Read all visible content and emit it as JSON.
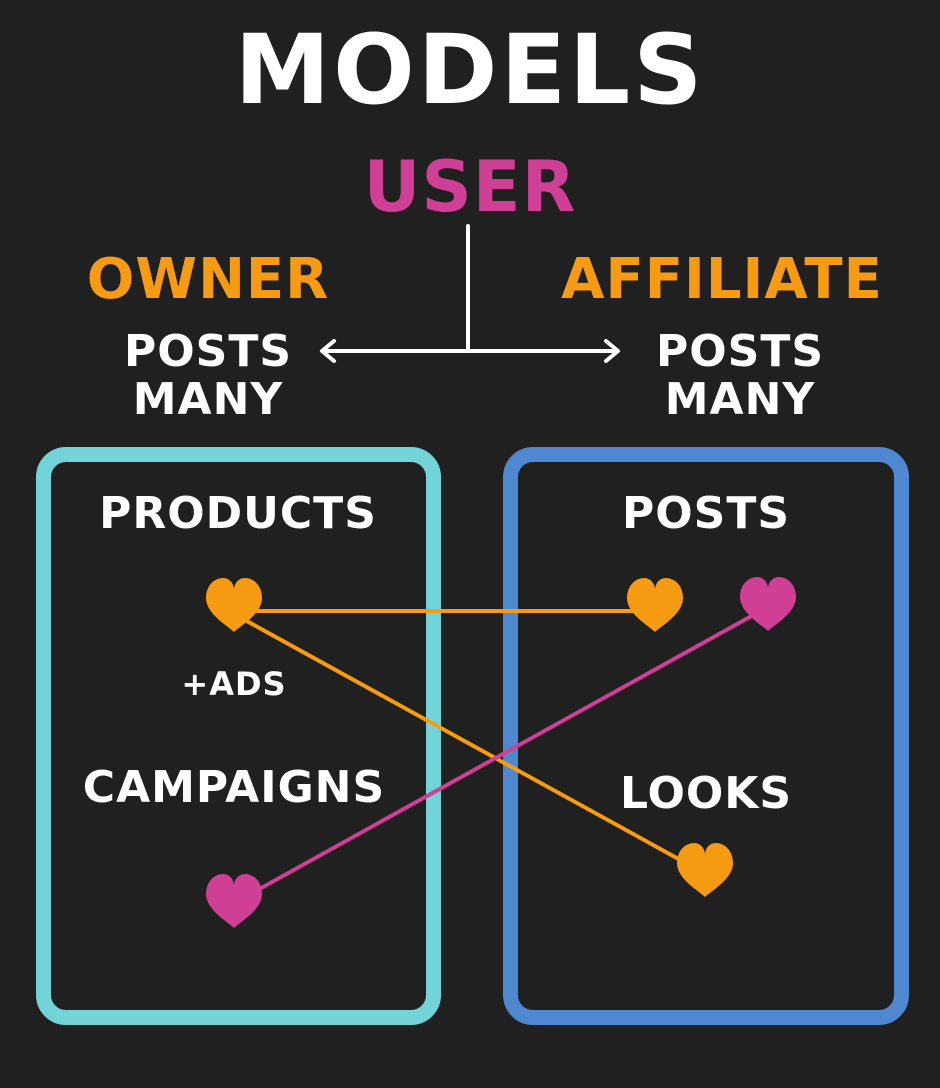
{
  "title": "MODELS",
  "root": {
    "label": "USER"
  },
  "roles": [
    {
      "id": "owner",
      "label": "OWNER",
      "relation_line1": "POSTS",
      "relation_line2": "MANY"
    },
    {
      "id": "affiliate",
      "label": "AFFILIATE",
      "relation_line1": "POSTS",
      "relation_line2": "MANY"
    }
  ],
  "groups": {
    "owner": {
      "products": "PRODUCTS",
      "ads_note": "+ADS",
      "campaigns": "CAMPAIGNS"
    },
    "affiliate": {
      "posts": "POSTS",
      "looks": "LOOKS"
    }
  },
  "colors": {
    "background": "#202020",
    "title": "#ffffff",
    "user": "#cf3f95",
    "role": "#f79c12",
    "owner_box": "#72d3d9",
    "affiliate_box": "#4f87d0",
    "orange_link": "#f79c12",
    "pink_link": "#cf3f95"
  },
  "icons": [
    "heart-icon",
    "arrow-left-icon",
    "arrow-right-icon"
  ],
  "links": [
    {
      "from": "products",
      "to": "posts",
      "color": "orange"
    },
    {
      "from": "products",
      "to": "looks",
      "color": "orange"
    },
    {
      "from": "campaigns",
      "to": "posts",
      "color": "pink"
    }
  ]
}
